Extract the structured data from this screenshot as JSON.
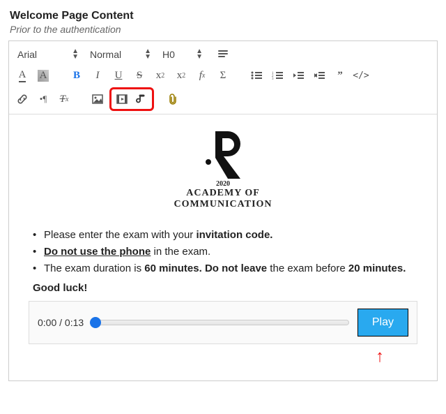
{
  "header": {
    "title": "Welcome Page Content",
    "subtitle": "Prior to the authentication"
  },
  "toolbar": {
    "font": "Arial",
    "size": "Normal",
    "heading": "H0"
  },
  "logo": {
    "year": "2020",
    "line1": "ACADEMY OF",
    "line2": "COMMUNICATION"
  },
  "bullets": [
    {
      "pre": "Please enter the exam with your ",
      "b1": "invitation code."
    },
    {
      "u": "Do not use the phone",
      "post": " in the exam."
    },
    {
      "pre": "The exam duration is ",
      "b1": "60 minutes. Do not leave",
      "mid": " the exam before ",
      "b2": "20 minutes."
    }
  ],
  "goodluck": "Good luck!",
  "audio": {
    "current": "0:00",
    "total": "0:13",
    "play": "Play"
  }
}
